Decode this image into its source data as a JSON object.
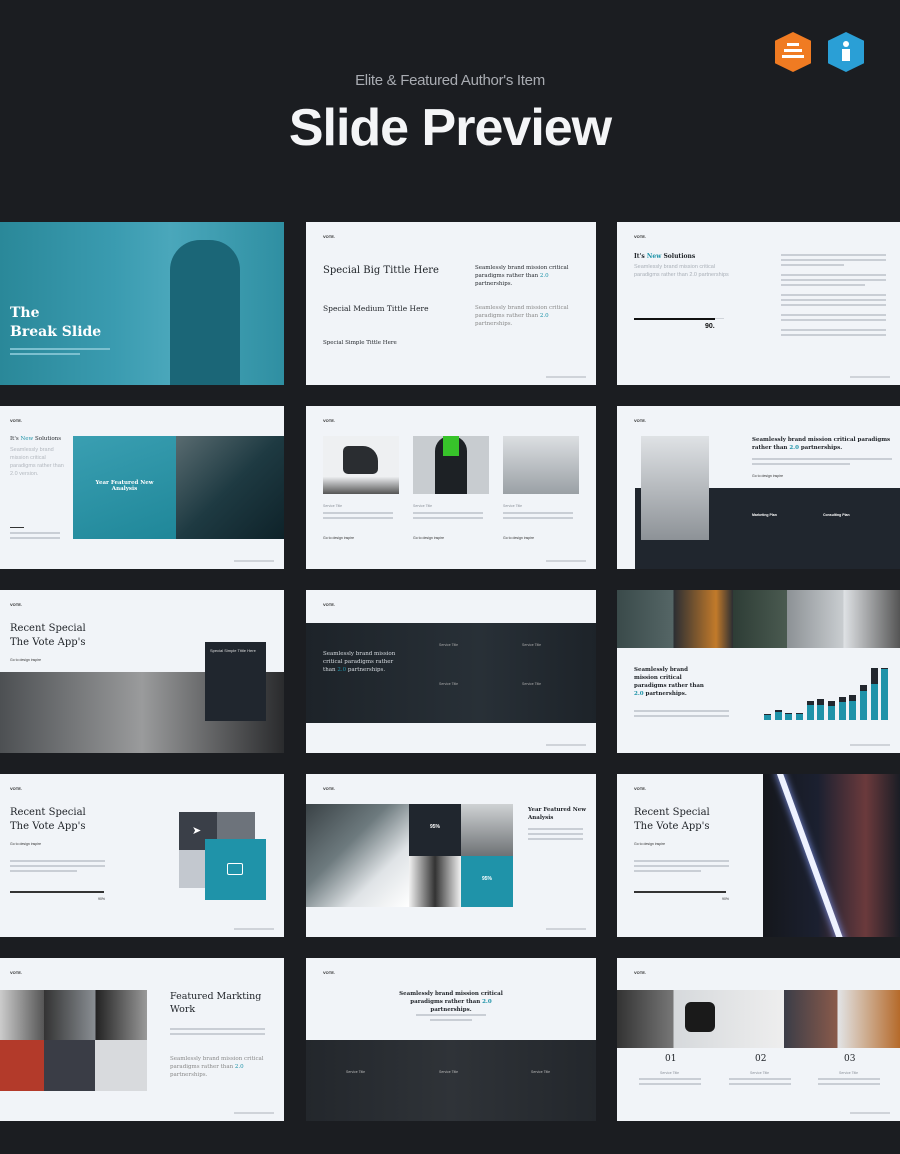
{
  "header": {
    "subtitle": "Elite & Featured Author's Item",
    "title": "Slide Preview",
    "badges": [
      {
        "icon": "elite-author-badge-icon",
        "color": "#f07b22"
      },
      {
        "icon": "featured-author-badge-icon",
        "color": "#2a9fd6"
      }
    ]
  },
  "colors": {
    "background": "#1b1d21",
    "accent": "#1f93a9",
    "slide": "#f1f4f8",
    "dark": "#20262e"
  },
  "brand": "VOTE.",
  "slides": {
    "break": {
      "line1": "The",
      "line2": "Break Slide"
    },
    "titles": {
      "big": "Special Big Tittle Here",
      "medium": "Special Medium Tittle Here",
      "simple": "Special Simple Tittle Here",
      "p_pre": "Seamlessly brand mission critical paradigms rather than ",
      "p_hl": "2.0",
      "p_post": " partnerships."
    },
    "solutions": {
      "pre": "It's ",
      "hl": "New",
      "post": " Solutions",
      "sub": "Seamlessly brand mission critical paradigms rather than 2.0 partnerships",
      "progress_label": "90.",
      "progress": 90
    },
    "solutions2": {
      "pre": "It's ",
      "hl": "New",
      "post": " Solutions",
      "sub": "Seamlessly brand mission critical paradigms rather than 2.0 version.",
      "box": "Year Featured New Analysis"
    },
    "services3": {
      "item": "Service Title",
      "link": "Go to design inspire"
    },
    "plans": {
      "pre": "Seamlessly brand mission critical paradigms rather than ",
      "hl": "2.0",
      "post": " partnerships.",
      "link": "Go to design inspire",
      "plan1": "Marketing Plan",
      "plan2": "Consulting Plan"
    },
    "recent": {
      "line1": "Recent Special",
      "line2": "The Vote App's",
      "link": "Go to design inspire",
      "card": "Special Simple Tittle Here"
    },
    "dark4": {
      "pre": "Seamlessly brand mission critical paradigms rather than ",
      "hl": "2.0",
      "post": " partnerships.",
      "item": "Service Title"
    },
    "chart": {
      "pre": "Seamlessly brand mission critical paradigms rather than ",
      "hl": "2.0",
      "post": " partnerships.",
      "totals": [
        12,
        20,
        14,
        14,
        36,
        40,
        36,
        44,
        48,
        68,
        100,
        100
      ],
      "teal": [
        9,
        16,
        11,
        11,
        28,
        28,
        26,
        34,
        36,
        56,
        70,
        98
      ]
    },
    "tiles": {
      "line1": "Recent Special",
      "line2": "The Vote App's",
      "link": "Go to design inspire",
      "progress_label": "90%"
    },
    "analysis": {
      "title": "Year Featured New Analysis",
      "stat1": "95%",
      "stat2": "95%"
    },
    "neon": {
      "line1": "Recent Special",
      "line2": "The Vote App's",
      "link": "Go to design inspire",
      "progress_label": "90%"
    },
    "featured": {
      "title": "Featured Markting Work",
      "pre": "Seamlessly brand mission critical paradigms rather than ",
      "hl": "2.0",
      "post": " partnerships."
    },
    "centered": {
      "pre": "Seamlessly brand mission critical paradigms rather than ",
      "hl": "2.0",
      "post": " partnerships.",
      "item": "Service Title"
    },
    "numbers": {
      "n1": "01",
      "n2": "02",
      "n3": "03",
      "item": "Service Title"
    }
  }
}
